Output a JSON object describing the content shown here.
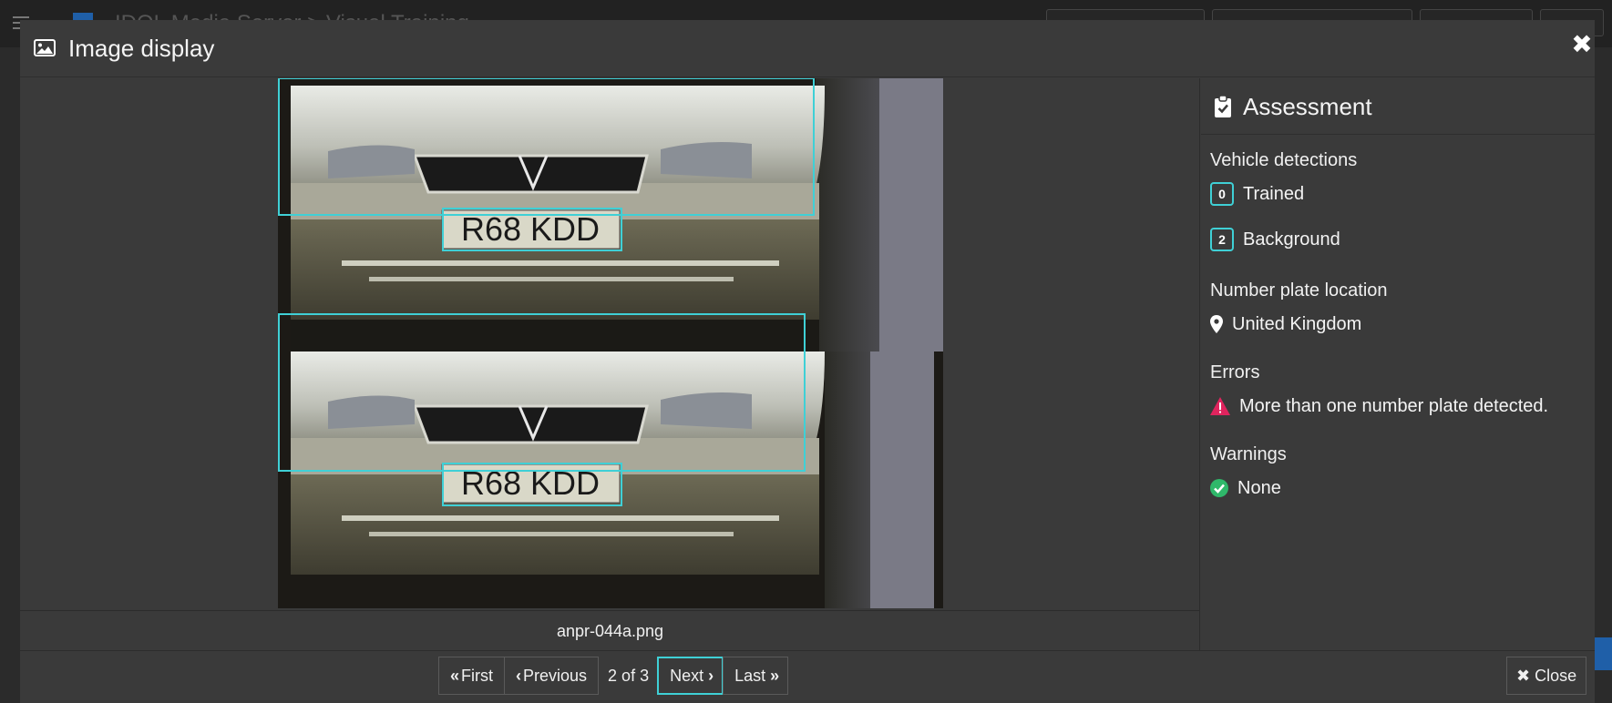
{
  "background": {
    "app_title": "IDOL Media Server > Visual Training"
  },
  "modal": {
    "title": "Image display",
    "title_icon": "image-icon",
    "close_icon": "close-icon",
    "close_glyph": "✖"
  },
  "image": {
    "filename": "anpr-044a.png",
    "plate_text": "R68 KDD",
    "detection_box_color": "#3fd0d6"
  },
  "assessment": {
    "title": "Assessment",
    "vehicle_detections_label": "Vehicle detections",
    "trained_count": "0",
    "trained_label": "Trained",
    "background_count": "2",
    "background_label": "Background",
    "location_label": "Number plate location",
    "location_value": "United Kingdom",
    "errors_label": "Errors",
    "error_text": "More than one number plate detected.",
    "warnings_label": "Warnings",
    "warnings_value": "None",
    "colors": {
      "error": "#e0245e",
      "ok": "#2fb86a",
      "accent": "#3fd0d6"
    }
  },
  "pager": {
    "first_label": "First",
    "previous_label": "Previous",
    "position": "2 of 3",
    "next_label": "Next",
    "last_label": "Last"
  },
  "footer": {
    "close_label": "Close"
  }
}
